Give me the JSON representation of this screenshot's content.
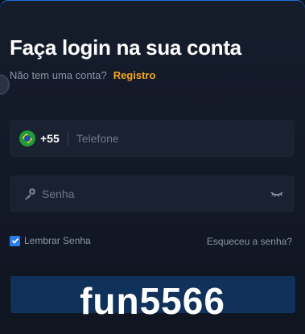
{
  "login": {
    "title": "Faça login na sua conta",
    "no_account_text": "Não tem uma conta?",
    "register_link": "Registro"
  },
  "phone_field": {
    "country_flag_icon": "brazil-flag-icon",
    "country_code": "+55",
    "placeholder": "Telefone"
  },
  "password_field": {
    "icon": "key-icon",
    "placeholder": "Senha",
    "visibility_icon": "eye-closed-icon"
  },
  "remember": {
    "label": "Lembrar Senha",
    "checked": true
  },
  "forgot_password_link": "Esqueceu a senha?",
  "watermark": "fun5566",
  "colors": {
    "accent": "#f5a623",
    "checkbox": "#2b7de9",
    "button": "#10315a"
  }
}
